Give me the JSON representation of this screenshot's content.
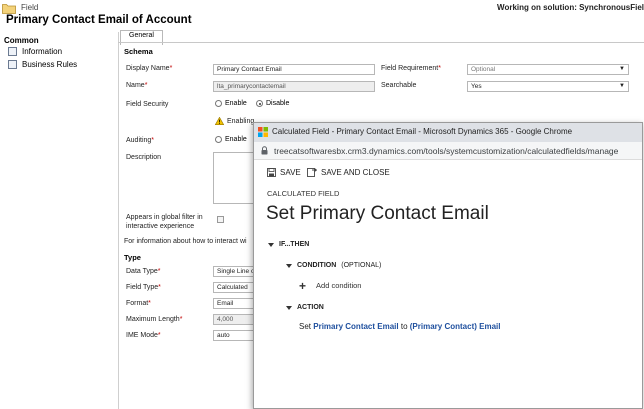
{
  "header": {
    "subtitle": "Field",
    "title": "Primary Contact Email of Account",
    "solution": "Working on solution: SynchronousFiel"
  },
  "nav": {
    "group": "Common",
    "items": [
      {
        "label": "Information",
        "icon": "information-icon"
      },
      {
        "label": "Business Rules",
        "icon": "business-rules-icon"
      }
    ]
  },
  "form": {
    "tab": "General",
    "schema_title": "Schema",
    "display_name": {
      "label": "Display Name",
      "value": "Primary Contact Email"
    },
    "field_requirement": {
      "label": "Field Requirement",
      "value": "Optional"
    },
    "name": {
      "label": "Name",
      "value": "lta_primarycontactemail"
    },
    "searchable": {
      "label": "Searchable",
      "value": "Yes"
    },
    "field_security": {
      "label": "Field Security",
      "enable": "Enable",
      "disable": "Disable"
    },
    "warning": "Enabling",
    "auditing": {
      "label": "Auditing",
      "enable": "Enable"
    },
    "description": {
      "label": "Description"
    },
    "global_filter": {
      "line1": "Appears in global filter in",
      "line2": "interactive experience"
    },
    "info_text": "For information about how to interact wi",
    "type_title": "Type",
    "data_type": {
      "label": "Data Type",
      "value": "Single Line o"
    },
    "field_type": {
      "label": "Field Type",
      "value": "Calculated"
    },
    "format": {
      "label": "Format",
      "value": "Email"
    },
    "max_length": {
      "label": "Maximum Length",
      "value": "4,000"
    },
    "ime_mode": {
      "label": "IME Mode",
      "value": "auto"
    }
  },
  "popup": {
    "window_title": "Calculated Field - Primary Contact Email - Microsoft Dynamics 365 - Google Chrome",
    "url": "treecatsoftwaresbx.crm3.dynamics.com/tools/systemcustomization/calculatedfields/manage",
    "save": "SAVE",
    "save_close": "SAVE AND CLOSE",
    "calc_label": "CALCULATED FIELD",
    "heading": "Set Primary Contact Email",
    "ifthen": "IF...THEN",
    "condition": "CONDITION",
    "optional": "(OPTIONAL)",
    "add_condition": "Add condition",
    "action": "ACTION",
    "action_set": "Set",
    "action_field": "Primary Contact Email",
    "action_to": "to",
    "action_value": "(Primary Contact) Email"
  },
  "colors": {
    "link_blue": "#1e4f9e",
    "required_red": "#c00000"
  }
}
